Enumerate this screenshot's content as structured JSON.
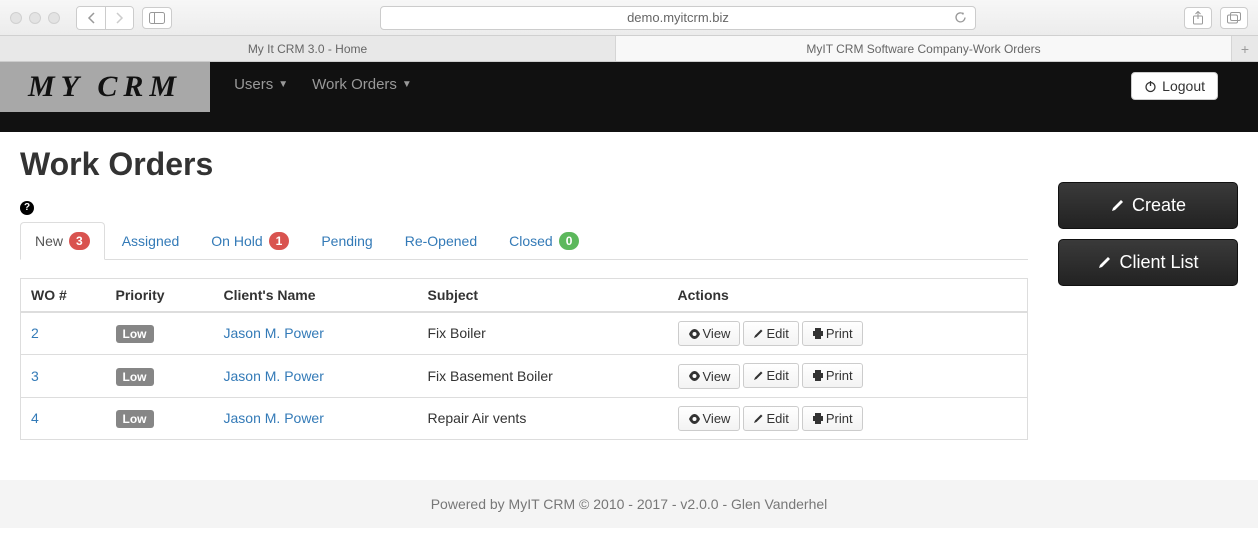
{
  "browser": {
    "url": "demo.myitcrm.biz",
    "tabs": [
      {
        "label": "My It CRM 3.0 - Home",
        "active": false
      },
      {
        "label": "MyIT CRM Software Company-Work Orders",
        "active": true
      }
    ]
  },
  "app_nav": {
    "logo": "MY CRM",
    "items": [
      {
        "label": "Users"
      },
      {
        "label": "Work Orders"
      }
    ],
    "logout": "Logout"
  },
  "page": {
    "title": "Work Orders"
  },
  "tabs": [
    {
      "label": "New",
      "badge": "3",
      "badge_class": "badge-red",
      "active": true
    },
    {
      "label": "Assigned",
      "badge": null
    },
    {
      "label": "On Hold",
      "badge": "1",
      "badge_class": "badge-red"
    },
    {
      "label": "Pending",
      "badge": null
    },
    {
      "label": "Re-Opened",
      "badge": null
    },
    {
      "label": "Closed",
      "badge": "0",
      "badge_class": "badge-green"
    }
  ],
  "table": {
    "headers": {
      "wo": "WO #",
      "priority": "Priority",
      "client": "Client's Name",
      "subject": "Subject",
      "actions": "Actions"
    },
    "action_labels": {
      "view": "View",
      "edit": "Edit",
      "print": "Print"
    },
    "rows": [
      {
        "wo": "2",
        "priority": "Low",
        "client": "Jason M. Power",
        "subject": "Fix Boiler"
      },
      {
        "wo": "3",
        "priority": "Low",
        "client": "Jason M. Power",
        "subject": "Fix Basement Boiler"
      },
      {
        "wo": "4",
        "priority": "Low",
        "client": "Jason M. Power",
        "subject": "Repair Air vents"
      }
    ]
  },
  "sidebar": {
    "create": "Create",
    "client_list": "Client List"
  },
  "footer": {
    "text": "Powered by MyIT CRM © 2010 - 2017 - v2.0.0 - Glen Vanderhel"
  }
}
